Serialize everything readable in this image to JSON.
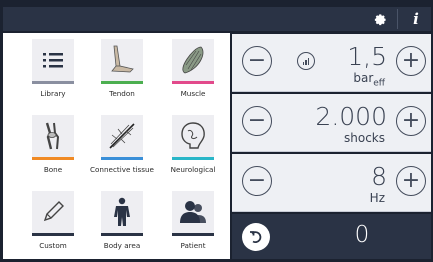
{
  "topbar": {
    "settings_icon": "gear-icon",
    "info_icon": "info-icon",
    "info_label": "i"
  },
  "menu": {
    "tiles": [
      {
        "label": "Library",
        "icon": "list-icon",
        "color": "#8a8fa0"
      },
      {
        "label": "Tendon",
        "icon": "tendon-icon",
        "color": "#4caf50"
      },
      {
        "label": "Muscle",
        "icon": "muscle-icon",
        "color": "#e24a8b"
      },
      {
        "label": "Bone",
        "icon": "bone-icon",
        "color": "#f08a24"
      },
      {
        "label": "Connective tissue",
        "icon": "connective-tissue-icon",
        "color": "#3a8fd8"
      },
      {
        "label": "Neurological",
        "icon": "brain-icon",
        "color": "#29b6c8"
      },
      {
        "label": "Custom",
        "icon": "pencil-icon",
        "color": "#2a3345"
      },
      {
        "label": "Body area",
        "icon": "body-icon",
        "color": "#2a3345"
      },
      {
        "label": "Patient",
        "icon": "patient-icon",
        "color": "#2a3345"
      }
    ]
  },
  "controls": {
    "pressure": {
      "value": "1,5",
      "unit": "bar",
      "unit_sub": "eff"
    },
    "shocks": {
      "value": "2.000",
      "unit": "shocks"
    },
    "frequency": {
      "value": "8",
      "unit": "Hz"
    },
    "minus_label": "−",
    "plus_label": "+"
  },
  "footer": {
    "counter": "0"
  }
}
